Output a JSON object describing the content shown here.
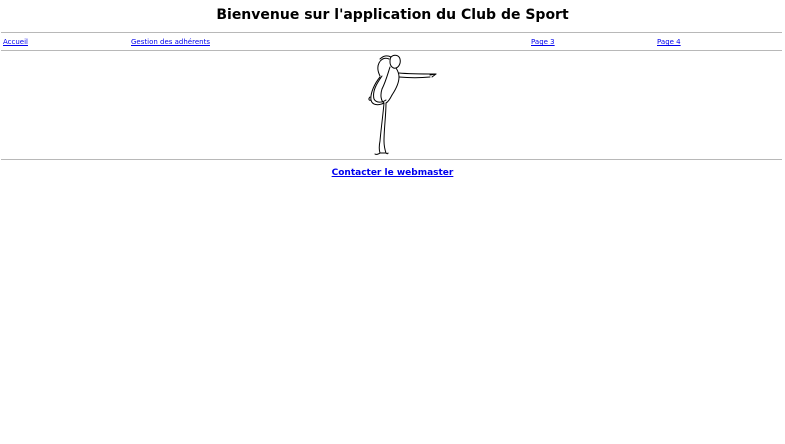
{
  "header": {
    "title": "Bienvenue sur l'application du Club de Sport"
  },
  "nav": {
    "items": [
      {
        "label": "Accueil"
      },
      {
        "label": "Gestion des adhérents"
      },
      {
        "label": "Page 3"
      },
      {
        "label": "Page 4"
      }
    ]
  },
  "main": {
    "illustration_icon": "dancer-pose-sketch"
  },
  "footer": {
    "contact_label": "Contacter le webmaster"
  },
  "colors": {
    "link": "#0000ee",
    "rule": "#b8b8b8"
  }
}
